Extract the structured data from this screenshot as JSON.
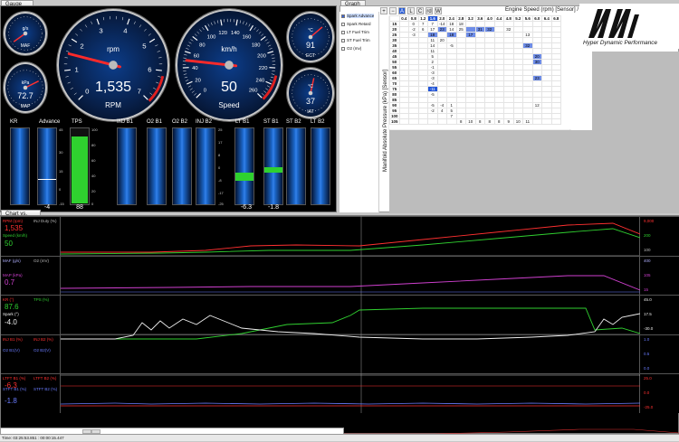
{
  "tabs": {
    "gauge": "Gauge",
    "graph": "Graph",
    "chart": "Chart vs. Time"
  },
  "gauges": {
    "maf": {
      "title": "MAF",
      "unit": "g/s"
    },
    "map": {
      "title": "MAP",
      "unit": "kPa",
      "value": "72.7"
    },
    "rpm": {
      "title": "RPM",
      "unit": "rpm",
      "value": "1,535",
      "value_fraction": 0.22
    },
    "speed": {
      "title": "Speed",
      "unit": "km/h",
      "value": "50",
      "value_fraction": 0.19
    },
    "ect": {
      "title": "ECT",
      "unit": "°C",
      "value": "91"
    },
    "iat": {
      "title": "IAT",
      "unit": "°C",
      "value": "37"
    },
    "rpm_ticks": [
      "0",
      "1",
      "2",
      "3",
      "4",
      "5",
      "6",
      "7"
    ],
    "speed_ticks": [
      "0",
      "20",
      "40",
      "60",
      "80",
      "100",
      "120",
      "140",
      "160",
      "180",
      "200",
      "220",
      "240",
      "260"
    ]
  },
  "bars": [
    {
      "label": "KR",
      "value": "",
      "fill": 0
    },
    {
      "label": "Advance",
      "value": "-4",
      "fill": 0.35
    },
    {
      "label": "TPS",
      "value": "88",
      "fill": 0.88
    },
    {
      "label": "INJ B1",
      "value": "",
      "fill": 0
    },
    {
      "label": "O2 B1",
      "value": "",
      "fill": 0
    },
    {
      "label": "O2 B2",
      "value": "",
      "fill": 0
    },
    {
      "label": "INJ B2",
      "value": "",
      "fill": 0
    },
    {
      "label": "LT B1",
      "value": "-6.3",
      "fill": 0.37
    },
    {
      "label": "ST B1",
      "value": "-1.8",
      "fill": 0.46
    },
    {
      "label": "ST B2",
      "value": "",
      "fill": 0
    },
    {
      "label": "LT B2",
      "value": "",
      "fill": 0
    }
  ],
  "bar_scales": {
    "advance": [
      "45",
      "30",
      "15",
      "0",
      "-15"
    ],
    "tps": [
      "100",
      "80",
      "60",
      "40",
      "20",
      "0"
    ],
    "trim": [
      "25",
      "17",
      "8",
      "0",
      "-8",
      "-17",
      "-25"
    ]
  },
  "legend": [
    "Spark Advance",
    "Spark Retard",
    "LT Fuel Trim",
    "ST Fuel Trim",
    "O2 (mv)"
  ],
  "toolbar": [
    "+",
    "−",
    "A",
    "L",
    "C",
    "rd",
    "W"
  ],
  "graph": {
    "x_title": "Engine Speed (rpm) [Sensor] / 1000",
    "y_title": "Manifold Absolute Pressure (kPa) [Sensor]",
    "cols": [
      "0.4",
      "0.8",
      "1.2",
      "1.6",
      "2.0",
      "2.4",
      "2.8",
      "3.2",
      "3.6",
      "4.0",
      "4.4",
      "4.8",
      "5.2",
      "5.6",
      "6.0",
      "6.4",
      "6.8"
    ],
    "rows": [
      "15",
      "20",
      "25",
      "30",
      "35",
      "40",
      "45",
      "50",
      "55",
      "60",
      "65",
      "70",
      "75",
      "80",
      "85",
      "90",
      "95",
      "100",
      "105"
    ],
    "cells": [
      [
        "",
        "0",
        "7",
        "7",
        "-14",
        "18",
        "18",
        "",
        "",
        "",
        "",
        "",
        "",
        "",
        "",
        "",
        ""
      ],
      [
        "",
        "-2",
        "6",
        "17",
        "23",
        "14",
        "25",
        "",
        "31",
        "32",
        "",
        "32",
        "",
        "",
        "",
        "",
        ""
      ],
      [
        "",
        "-3",
        "",
        "18",
        "",
        "18",
        "",
        "17",
        "",
        "",
        "",
        "",
        "",
        "13",
        "",
        "",
        ""
      ],
      [
        "",
        "",
        "",
        "11",
        "20",
        "",
        "",
        "",
        "",
        "",
        "",
        "",
        "",
        "",
        "",
        "",
        ""
      ],
      [
        "",
        "",
        "",
        "14",
        "",
        "-5",
        "",
        "",
        "",
        "",
        "",
        "",
        "",
        "32",
        "",
        "",
        ""
      ],
      [
        "",
        "",
        "",
        "11",
        "",
        "",
        "",
        "",
        "",
        "",
        "",
        "",
        "",
        "",
        "",
        "",
        ""
      ],
      [
        "",
        "",
        "",
        "5",
        "",
        "",
        "",
        "",
        "",
        "",
        "",
        "",
        "",
        "",
        "20",
        "",
        ""
      ],
      [
        "",
        "",
        "",
        "2",
        "",
        "",
        "",
        "",
        "",
        "",
        "",
        "",
        "",
        "",
        "30",
        "",
        ""
      ],
      [
        "",
        "",
        "",
        "-1",
        "",
        "",
        "",
        "",
        "",
        "",
        "",
        "",
        "",
        "",
        "",
        "",
        ""
      ],
      [
        "",
        "",
        "",
        "-3",
        "",
        "",
        "",
        "",
        "",
        "",
        "",
        "",
        "",
        "",
        "",
        "",
        ""
      ],
      [
        "",
        "",
        "",
        "-3",
        "",
        "",
        "",
        "",
        "",
        "",
        "",
        "",
        "",
        "",
        "23",
        "",
        ""
      ],
      [
        "",
        "",
        "",
        "-4",
        "",
        "",
        "",
        "",
        "",
        "",
        "",
        "",
        "",
        "",
        "",
        "",
        ""
      ],
      [
        "",
        "",
        "",
        "-11",
        "",
        "",
        "",
        "",
        "",
        "",
        "",
        "",
        "",
        "",
        "",
        "",
        ""
      ],
      [
        "",
        "",
        "",
        "-5",
        "",
        "",
        "",
        "",
        "",
        "",
        "",
        "",
        "",
        "",
        "",
        "",
        ""
      ],
      [
        "",
        "",
        "",
        "",
        "",
        "",
        "",
        "",
        "",
        "",
        "",
        "",
        "",
        "",
        "",
        "",
        ""
      ],
      [
        "",
        "",
        "",
        "-5",
        "-4",
        "1",
        "",
        "",
        "",
        "",
        "",
        "",
        "",
        "",
        "12",
        "",
        ""
      ],
      [
        "",
        "",
        "",
        "-2",
        "4",
        "5",
        "",
        "",
        "",
        "",
        "",
        "",
        "",
        "",
        "",
        "",
        ""
      ],
      [
        "",
        "",
        "",
        "",
        "",
        "7",
        "",
        "",
        "",
        "",
        "",
        "",
        "",
        "",
        "",
        "",
        ""
      ],
      [
        "",
        "",
        "",
        "",
        "",
        "",
        "8",
        "10",
        "8",
        "8",
        "8",
        "9",
        "10",
        "11",
        "",
        "",
        ""
      ]
    ]
  },
  "logo": "Hyper Dynamic Performance",
  "chart": {
    "strips": [
      {
        "labels": [
          {
            "t": "RPM (rpm)",
            "c": "#ff3030"
          },
          {
            "t": "INJ Duty (%)",
            "c": "#bbbbbb"
          },
          {
            "t": "Speed (km/h)",
            "c": "#30d030"
          }
        ],
        "big": [
          {
            "t": "1,535",
            "c": "#ff3030"
          },
          {
            "t": "50",
            "c": "#30d030"
          }
        ],
        "right": [
          {
            "t": "9,000",
            "c": "#ff3030"
          },
          {
            "t": "200",
            "c": "#30d030"
          },
          {
            "t": "100",
            "c": "#bbbbbb"
          }
        ]
      },
      {
        "labels": [
          {
            "t": "MAF (g/s)",
            "c": "#b0b0ff"
          },
          {
            "t": "O2 (mV)",
            "c": "#bbbbbb"
          },
          {
            "t": "MAP (kPa)",
            "c": "#d040d0"
          }
        ],
        "big": [
          {
            "t": "0.7",
            "c": "#d040d0"
          }
        ],
        "right": [
          {
            "t": "400",
            "c": "#b0b0ff"
          },
          {
            "t": "105",
            "c": "#d040d0"
          },
          {
            "t": "15",
            "c": "#d040d0"
          }
        ]
      },
      {
        "labels": [
          {
            "t": "KR (°)",
            "c": "#ff3030"
          },
          {
            "t": "TPS (%)",
            "c": "#30d030"
          },
          {
            "t": "Spark (°)",
            "c": "#eeeeee"
          }
        ],
        "big": [
          {
            "t": "87.6",
            "c": "#30d030"
          },
          {
            "t": "-4.0",
            "c": "#eeeeee"
          }
        ],
        "right": [
          {
            "t": "45.0",
            "c": "#eeeeee"
          },
          {
            "t": "17.5",
            "c": "#eeeeee"
          },
          {
            "t": "-30.0",
            "c": "#eeeeee"
          }
        ]
      },
      {
        "labels": [
          {
            "t": "INJ B1 (%)",
            "c": "#ff3030"
          },
          {
            "t": "INJ B2 (%)",
            "c": "#ff3030"
          },
          {
            "t": "O2 B1(V)",
            "c": "#6a7cff"
          },
          {
            "t": "O2 B2(V)",
            "c": "#6a7cff"
          }
        ],
        "big": [],
        "right": [
          {
            "t": "1.0",
            "c": "#6a7cff"
          },
          {
            "t": "0.5",
            "c": "#6a7cff"
          },
          {
            "t": "0.0",
            "c": "#6a7cff"
          }
        ]
      },
      {
        "labels": [
          {
            "t": "LTFT B1 (%)",
            "c": "#ff3030"
          },
          {
            "t": "LTFT B2 (%)",
            "c": "#ff3030"
          },
          {
            "t": "STFT B1 (%)",
            "c": "#6a7cff"
          },
          {
            "t": "STFT B2 (%)",
            "c": "#6a7cff"
          }
        ],
        "big": [
          {
            "t": "-6.3",
            "c": "#ff3030"
          },
          {
            "t": "-1.8",
            "c": "#6a7cff"
          }
        ],
        "right": [
          {
            "t": "25.0",
            "c": "#ff3030"
          },
          {
            "t": "0.0",
            "c": "#ff3030"
          },
          {
            "t": "-25.0",
            "c": "#ff3030"
          }
        ]
      }
    ]
  },
  "status": "Time: 03:25:53.851 : 00:00:15.447"
}
